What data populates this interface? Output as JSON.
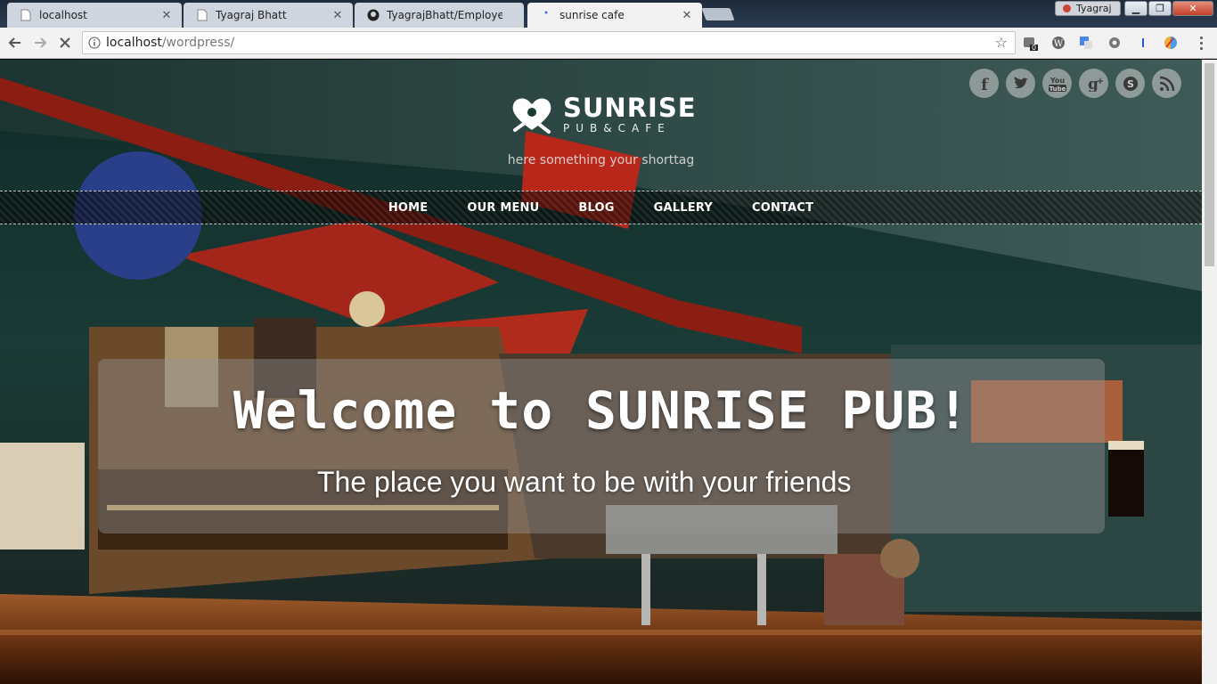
{
  "browser": {
    "tabs": [
      {
        "title": "localhost",
        "icon": "page-icon",
        "active": false
      },
      {
        "title": "Tyagraj Bhatt",
        "icon": "page-icon",
        "active": false
      },
      {
        "title": "TyagrajBhatt/Employee-",
        "icon": "github-icon",
        "active": false
      },
      {
        "title": "sunrise cafe",
        "icon": "loading-icon",
        "active": true
      }
    ],
    "user_label": "Tyagraj",
    "url_host": "localhost",
    "url_path": "/wordpress/",
    "extension_badge": "0"
  },
  "site": {
    "logo_name": "SUNRISE",
    "logo_sub": "PUB&CAFE",
    "tagline": "here something your shorttag",
    "social": [
      {
        "name": "facebook",
        "glyph": "f"
      },
      {
        "name": "twitter",
        "glyph": "t"
      },
      {
        "name": "youtube",
        "glyph": "You"
      },
      {
        "name": "google-plus",
        "glyph": "g+"
      },
      {
        "name": "skype",
        "glyph": "S"
      },
      {
        "name": "rss",
        "glyph": "≋"
      }
    ],
    "menu": [
      "HOME",
      "OUR MENU",
      "BLOG",
      "GALLERY",
      "CONTACT"
    ],
    "hero_title": "Welcome to SUNRISE PUB!",
    "hero_subtitle": "The place you want to be with your friends"
  }
}
